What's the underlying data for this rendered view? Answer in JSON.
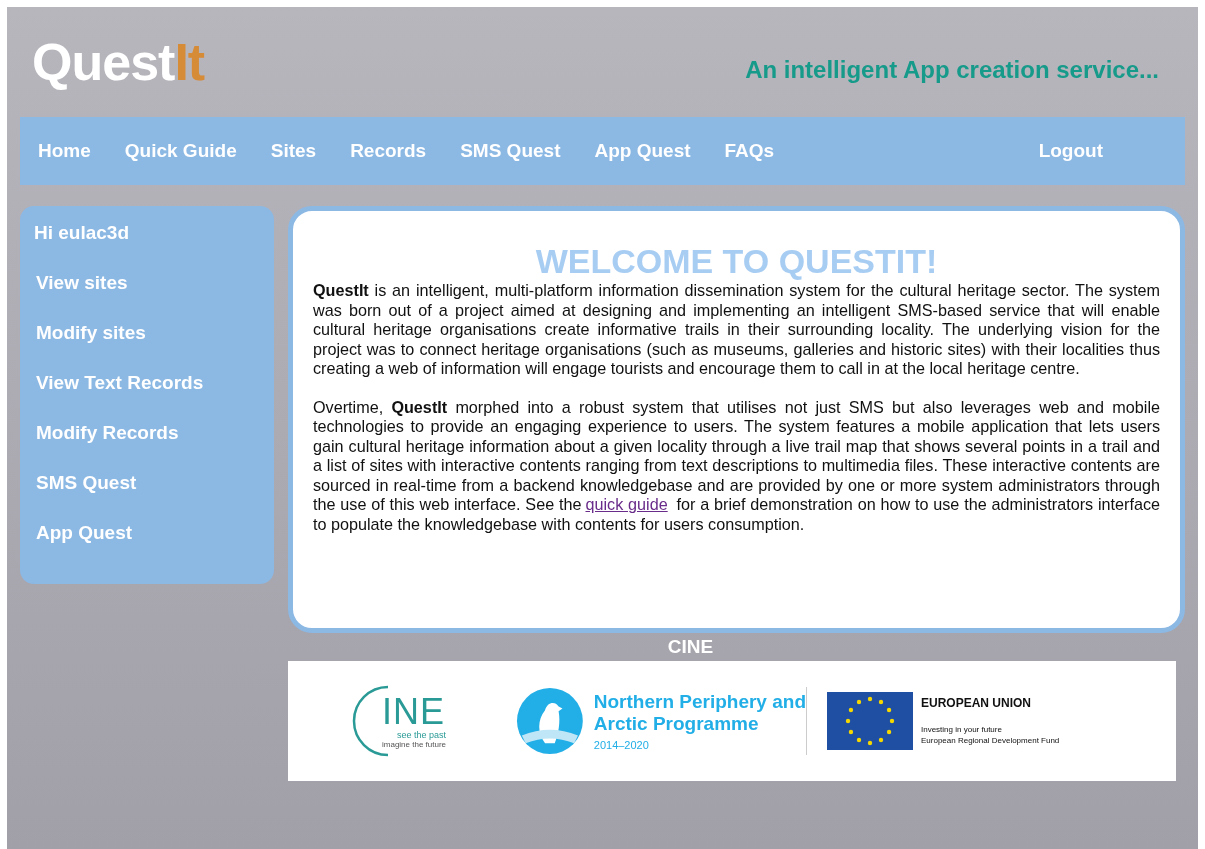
{
  "header": {
    "logo": {
      "main": "Quest",
      "accent": "It"
    },
    "tagline": "An intelligent App creation service..."
  },
  "nav": {
    "items": [
      "Home",
      "Quick Guide",
      "Sites",
      "Records",
      "SMS Quest",
      "App Quest",
      "FAQs"
    ],
    "logout": "Logout"
  },
  "sidebar": {
    "greeting": "Hi eulac3d",
    "items": [
      "View sites",
      "Modify sites",
      "View Text Records",
      "Modify Records",
      "SMS Quest",
      "App Quest"
    ]
  },
  "main": {
    "title": "WELCOME TO QUESTIT!",
    "paragraphs": [
      {
        "before": "**QuestIt** is an intelligent, multi-platform information dissemination system for the cultural heritage sector. The system was born out of a project aimed at designing and implementing an intelligent SMS-based service that will enable cultural heritage organisations create informative trails in their surrounding locality. The underlying vision for the project was to connect heritage organisations (such as museums, galleries and historic sites) with their localities thus creating a web of information will engage tourists and encourage them to call in at the local heritage centre."
      },
      {
        "before": "Overtime, **QuestIt** morphed into a robust system that utilises not just SMS but also leverages web and mobile technologies to provide an engaging experience to users. The system features a mobile application that lets users gain cultural heritage information about a given locality through a live trail map that shows several points in a trail and a list of sites with interactive contents ranging from text descriptions to multimedia files. These interactive contents are sourced in real-time from a backend knowledgebase and are provided by one or more system administrators through the use of this web interface. See the",
        "link": "quick guide",
        "after": "for a brief demonstration on how to use the administrators interface to populate the knowledgebase with contents for users consumption."
      }
    ]
  },
  "footer": {
    "label": "CINE",
    "cine": {
      "name": "INE",
      "line1": "see the past",
      "line2": "imagine the future"
    },
    "npa": {
      "name1": "Northern Periphery and",
      "name2": "Arctic Programme",
      "years": "2014–2020"
    },
    "eu": {
      "name": "EUROPEAN UNION",
      "line1": "Investing in your future",
      "line2": "European Regional Development Fund"
    }
  }
}
